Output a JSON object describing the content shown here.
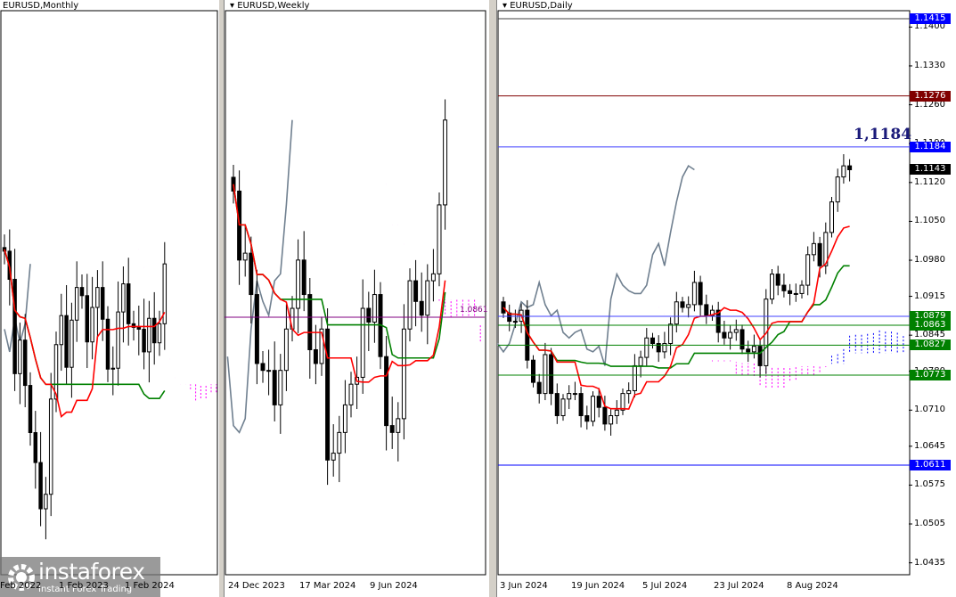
{
  "panels": {
    "monthly": {
      "title": "EURUSD,Monthly",
      "xlabels": [
        "Feb 2022",
        "1 Feb 2023",
        "1 Feb 2024"
      ]
    },
    "weekly": {
      "title": "EURUSD,Weekly",
      "xlabels": [
        "24 Dec 2023",
        "17 Mar 2024",
        "9 Jun 2024"
      ],
      "level_label": "1.0861"
    },
    "daily": {
      "title": "EURUSD,Daily",
      "xlabels": [
        "3 Jun 2024",
        "19 Jun 2024",
        "5 Jul 2024",
        "23 Jul 2024",
        "8 Aug 2024"
      ],
      "annotation": "1,1184"
    }
  },
  "price_axis": {
    "ticks": [
      "1.1400",
      "1.1330",
      "1.1260",
      "1.1190",
      "1.1120",
      "1.1050",
      "1.0980",
      "1.0915",
      "1.0845",
      "1.0780",
      "1.0710",
      "1.0645",
      "1.0575",
      "1.0505",
      "1.0435"
    ]
  },
  "levels": [
    {
      "label": "1.1415",
      "color": "#0000ff",
      "line": "#404040"
    },
    {
      "label": "1.1276",
      "color": "#800000",
      "line": "#800000"
    },
    {
      "label": "1.1184",
      "color": "#0000ff",
      "line": "#4040ff"
    },
    {
      "label": "1.1143",
      "color": "#000000",
      "line": null
    },
    {
      "label": "1.0879",
      "color": "#008000",
      "line": "#4040ff"
    },
    {
      "label": "1.0863",
      "color": "#008000",
      "line": "#008000"
    },
    {
      "label": "1.0827",
      "color": "#008000",
      "line": "#008000"
    },
    {
      "label": "1.0773",
      "color": "#008000",
      "line": "#008000"
    },
    {
      "label": "1.0611",
      "color": "#0000ff",
      "line": "#0000ff"
    }
  ],
  "logo": {
    "name": "instaforex",
    "tagline": "Instant Forex Trading"
  },
  "colors": {
    "tenkan": "#ff0000",
    "kijun": "#008000",
    "chikou": "#708090",
    "cloud_up": "#0000ff",
    "cloud_down": "#ff00ff"
  },
  "chart_data": [
    {
      "type": "candlestick",
      "name": "EURUSD Monthly",
      "x_start": "Feb 2022",
      "closes": [
        1.122,
        1.1065,
        1.0545,
        1.073,
        1.048,
        1.022,
        1.0055,
        0.98,
        0.988,
        1.0405,
        1.0705,
        1.0865,
        1.058,
        1.084,
        1.102,
        1.0975,
        1.072,
        1.091,
        1.102,
        1.0845,
        1.057,
        1.0575,
        1.0885,
        1.104,
        1.082,
        1.08,
        1.079,
        1.0665,
        1.085,
        1.0715,
        1.082,
        1.115
      ]
    },
    {
      "type": "candlestick",
      "name": "EURUSD Weekly",
      "x_start": "24 Dec 2023",
      "closes": [
        1.104,
        1.094,
        1.095,
        1.089,
        1.079,
        1.078,
        1.078,
        1.073,
        1.078,
        1.084,
        1.087,
        1.094,
        1.089,
        1.081,
        1.079,
        1.084,
        1.065,
        1.066,
        1.069,
        1.073,
        1.076,
        1.077,
        1.087,
        1.085,
        1.089,
        1.08,
        1.07,
        1.069,
        1.071,
        1.084,
        1.091,
        1.088,
        1.086,
        1.091,
        1.092,
        1.102,
        1.1143
      ]
    },
    {
      "type": "candlestick",
      "name": "EURUSD Daily",
      "x_start": "3 Jun 2024",
      "closes": [
        1.0885,
        1.087,
        1.087,
        1.089,
        1.08,
        1.076,
        1.074,
        1.081,
        1.074,
        1.07,
        1.073,
        1.074,
        1.074,
        1.07,
        1.069,
        1.0735,
        1.0715,
        1.0685,
        1.07,
        1.071,
        1.074,
        1.0745,
        1.079,
        1.0805,
        1.084,
        1.083,
        1.0815,
        1.083,
        1.0865,
        1.0905,
        1.0895,
        1.09,
        1.094,
        1.09,
        1.088,
        1.089,
        1.085,
        1.084,
        1.085,
        1.0855,
        1.082,
        1.0815,
        1.0825,
        1.079,
        1.091,
        1.0955,
        1.0935,
        1.0925,
        1.092,
        1.092,
        1.0935,
        1.099,
        1.101,
        1.097,
        1.103,
        1.1085,
        1.113,
        1.115,
        1.1143
      ],
      "ylim": [
        1.0435,
        1.1415
      ]
    }
  ]
}
